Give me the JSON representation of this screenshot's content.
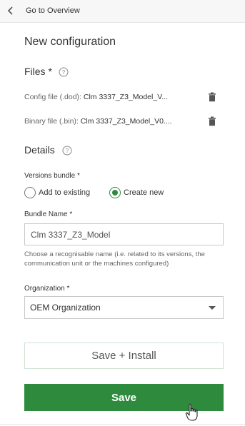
{
  "header": {
    "back_label": "Go to Overview"
  },
  "title": "New configuration",
  "files_section": {
    "title": "Files *",
    "config_file": {
      "label": "Config file (.dod):",
      "value": "Clm 3337_Z3_Model_V..."
    },
    "binary_file": {
      "label": "Binary file (.bin):",
      "value": "Clm 3337_Z3_Model_V0...."
    }
  },
  "details_section": {
    "title": "Details",
    "versions_bundle": {
      "label": "Versions bundle *",
      "options": [
        {
          "label": "Add to existing",
          "selected": false
        },
        {
          "label": "Create new",
          "selected": true
        }
      ]
    },
    "bundle_name": {
      "label": "Bundle Name *",
      "value": "Clm 3337_Z3_Model",
      "hint": "Choose a recognisable name (i.e. related to its versions, the communication unit or the machines configured)"
    },
    "organization": {
      "label": "Organization *",
      "value": "OEM Organization"
    }
  },
  "actions": {
    "save_install_label": "Save + Install",
    "save_label": "Save"
  },
  "colors": {
    "accent": "#2e8b3d"
  }
}
